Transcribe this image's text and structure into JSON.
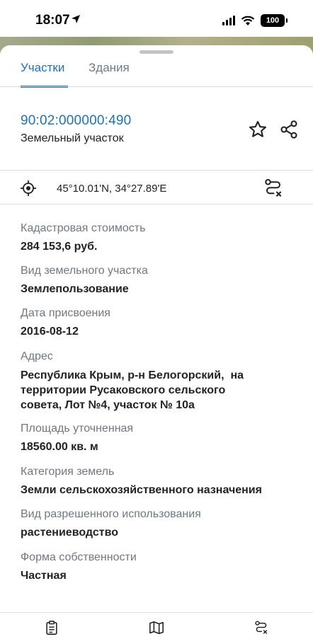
{
  "status": {
    "time": "18:07",
    "battery": "100"
  },
  "tabs": [
    {
      "label": "Участки",
      "active": true
    },
    {
      "label": "Здания",
      "active": false
    }
  ],
  "parcel": {
    "number": "90:02:000000:490",
    "type": "Земельный участок"
  },
  "location": {
    "coordinates": "45°10.01'N, 34°27.89'E"
  },
  "fields": [
    {
      "label": "Кадастровая стоимость",
      "value": "284 153,6 руб."
    },
    {
      "label": "Вид земельного участка",
      "value": "Землепользование"
    },
    {
      "label": "Дата присвоения",
      "value": "2016-08-12"
    },
    {
      "label": "Адрес",
      "value_lines": [
        "Республика Крым, р-н Белогорский,  на",
        "территории Русаковского сельского",
        "совета, Лот №4, участок № 10а"
      ]
    },
    {
      "label": "Площадь уточненная",
      "value": "18560.00 кв. м"
    },
    {
      "label": "Категория земель",
      "value": "Земли сельскохозяйственного назначения"
    },
    {
      "label": "Вид разрешенного использования",
      "value": "растениеводство"
    },
    {
      "label": "Форма собственности",
      "value": "Частная"
    }
  ],
  "colors": {
    "accent": "#2472a6",
    "label_gray": "#6f7880"
  },
  "icons": {
    "location_arrow": "location-arrow-icon",
    "star": "star-icon",
    "share": "share-icon",
    "locate": "locate-target-icon",
    "route_clear": "route-clear-icon",
    "nav_clipboard": "clipboard-icon",
    "nav_map": "map-icon",
    "nav_route": "route-icon"
  }
}
